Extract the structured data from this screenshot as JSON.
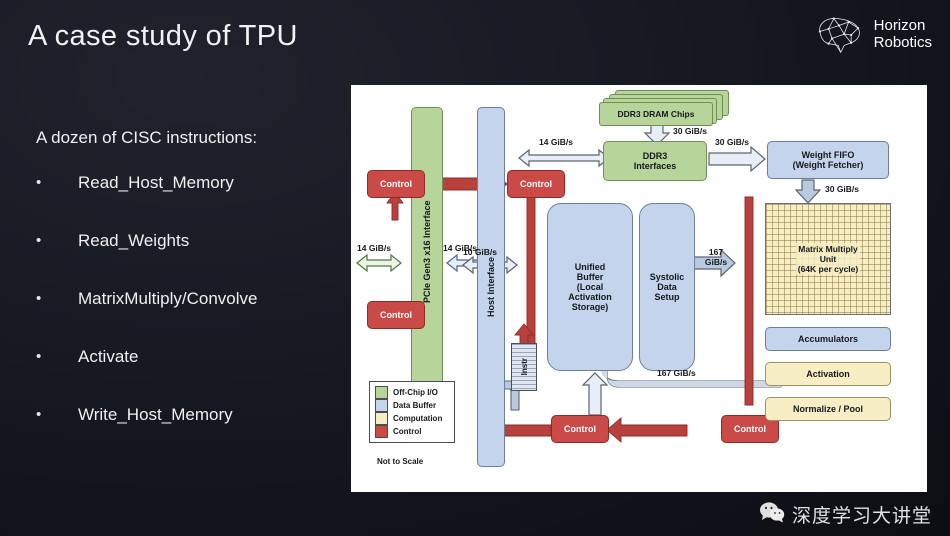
{
  "slide": {
    "title": "A case study of TPU",
    "lead": "A dozen of CISC instructions:",
    "bullet_marker": "•",
    "bullets": [
      "Read_Host_Memory",
      "Read_Weights",
      "MatrixMultiply/Convolve",
      "Activate",
      "Write_Host_Memory"
    ]
  },
  "logo": {
    "icon": "brain-network-icon",
    "line1": "Horizon",
    "line2": "Robotics"
  },
  "watermark": {
    "icon": "wechat-icon",
    "text": "深度学习大讲堂"
  },
  "diagram": {
    "caption": "Not to Scale",
    "blocks": {
      "pcie": "PCIe Gen3 x16\nInterface",
      "host_interface": "Host Interface",
      "dram": "DDR3 DRAM Chips",
      "ddr3_interfaces": "DDR3\nInterfaces",
      "weight_fifo": "Weight FIFO\n(Weight Fetcher)",
      "unified_buffer": "Unified\nBuffer\n(Local\nActivation\nStorage)",
      "systolic": "Systolic\nData\nSetup",
      "mmu": "Matrix Multiply\nUnit\n(64K per cycle)",
      "accumulators": "Accumulators",
      "activation": "Activation",
      "normalize_pool": "Normalize / Pool",
      "instr": "Instr",
      "control": "Control"
    },
    "bandwidths": {
      "pcie_left": "14 GiB/s",
      "pcie_right": "14 GiB/s",
      "dram_to_ddr3": "30 GiB/s",
      "ddr3_to_fifo": "30 GiB/s",
      "fifo_to_mmu": "30 GiB/s",
      "host_to_ub": "10 GiB/s",
      "systolic_to_mmu": "167 GiB/s",
      "pool_to_ub": "167 GiB/s"
    },
    "legend": [
      {
        "label": "Off-Chip I/O",
        "color": "#b7d59a"
      },
      {
        "label": "Data Buffer",
        "color": "#c3d4ec"
      },
      {
        "label": "Computation",
        "color": "#f7eec6"
      },
      {
        "label": "Control",
        "color": "#c94a46"
      }
    ],
    "colors": {
      "off_chip_io": "#b7d59a",
      "data_buffer": "#c3d4ec",
      "computation": "#f7eec6",
      "control": "#c94a46",
      "panel_bg": "#ffffff"
    }
  }
}
